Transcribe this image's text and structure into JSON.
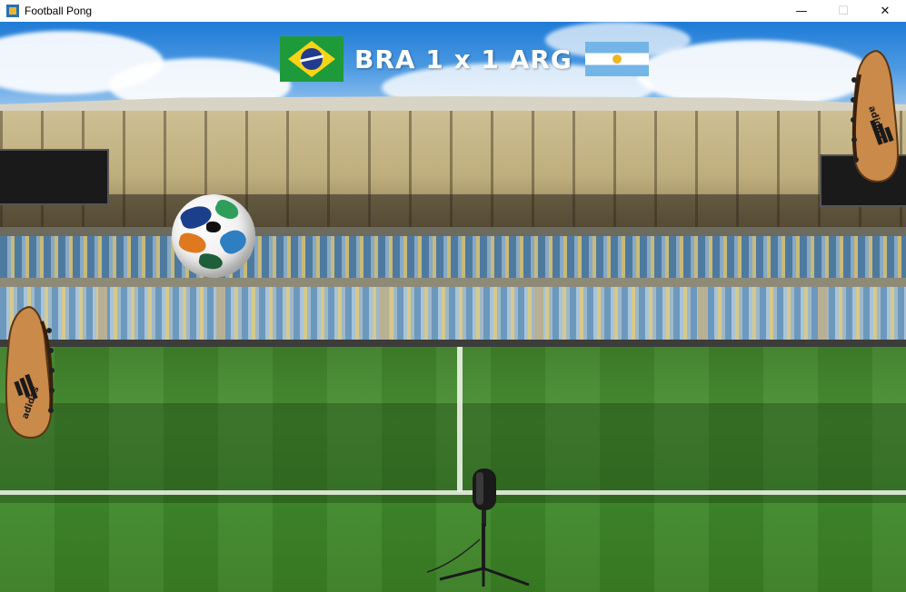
{
  "window": {
    "title": "Football Pong",
    "app_icon": "football-pong-app-icon",
    "controls": {
      "minimize": "—",
      "maximize": "☐",
      "close": "✕"
    }
  },
  "scoreboard": {
    "home_team": "BRA",
    "home_score": "1",
    "separator": "x",
    "away_score": "1",
    "away_team": "ARG",
    "text": "BRA 1 x 1 ARG",
    "home_flag": "brazil-flag",
    "away_flag": "argentina-flag"
  },
  "sprites": {
    "ball": "adidas-brazuca-football",
    "left_paddle": "adidas-boot-left",
    "right_paddle": "adidas-boot-right",
    "pitchside_object": "microphone-stand"
  },
  "boot_brand": "adidas",
  "colors": {
    "sky": "#2f86d9",
    "pitch": "#3f8a2b",
    "boot": "#c98a4a",
    "score_text": "#ffffff"
  }
}
